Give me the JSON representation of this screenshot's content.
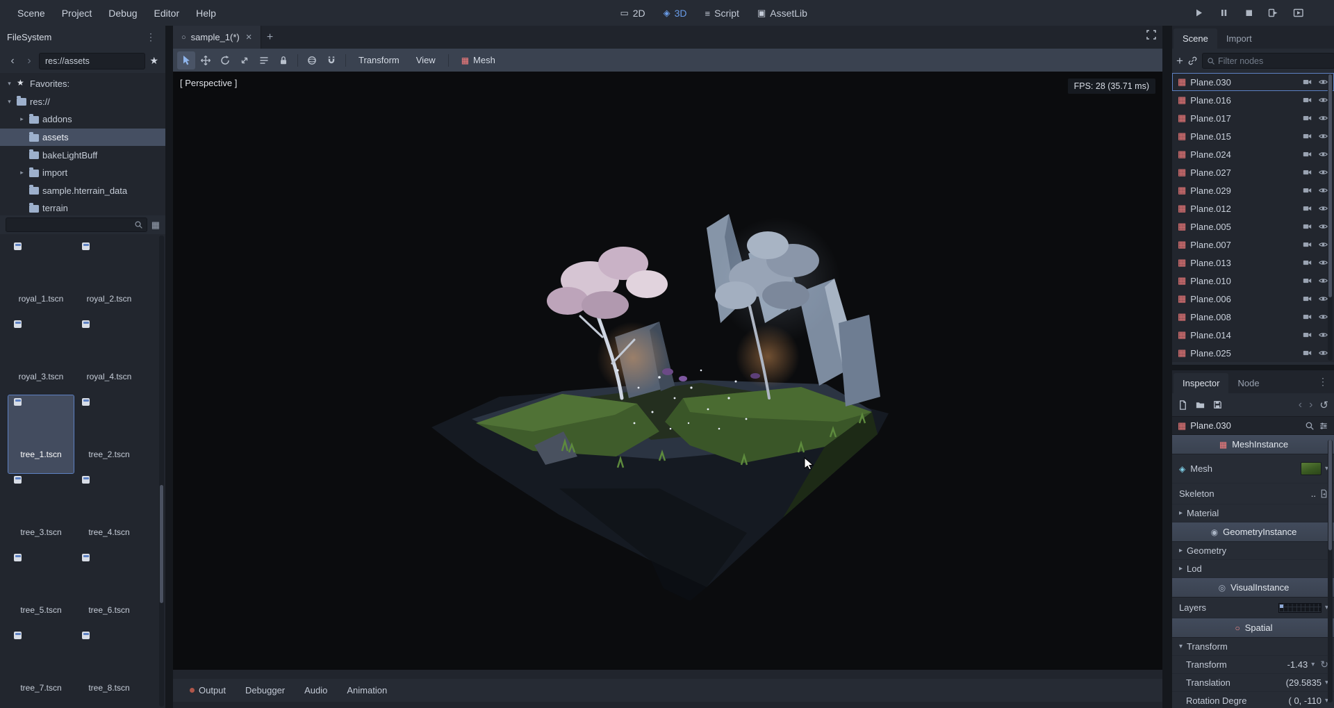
{
  "colors": {
    "accent": "#699ce8",
    "nodeicon": "#fc7f7f"
  },
  "menubar": {
    "menus": [
      "Scene",
      "Project",
      "Debug",
      "Editor",
      "Help"
    ],
    "workspaces": [
      {
        "label": "2D",
        "icon": "2d"
      },
      {
        "label": "3D",
        "icon": "3d",
        "active": true
      },
      {
        "label": "Script",
        "icon": "script"
      },
      {
        "label": "AssetLib",
        "icon": "assetlib"
      }
    ]
  },
  "filesystem": {
    "title": "FileSystem",
    "breadcrumb": "res://assets",
    "tree": [
      {
        "label": "Favorites:",
        "depth": 0,
        "icon": "star",
        "arrow": "down"
      },
      {
        "label": "res://",
        "depth": 0,
        "icon": "folder-open",
        "arrow": "down"
      },
      {
        "label": "addons",
        "depth": 1,
        "icon": "folder",
        "arrow": "right"
      },
      {
        "label": "assets",
        "depth": 1,
        "icon": "folder",
        "selected": true
      },
      {
        "label": "bakeLightBuff",
        "depth": 1,
        "icon": "folder"
      },
      {
        "label": "import",
        "depth": 1,
        "icon": "folder",
        "arrow": "right"
      },
      {
        "label": "sample.hterrain_data",
        "depth": 1,
        "icon": "folder"
      },
      {
        "label": "terrain",
        "depth": 1,
        "icon": "folder"
      }
    ],
    "files": [
      {
        "label": "royal_1.tscn",
        "type": "round",
        "colors": {
          "foliage": "#99953f",
          "trunk": "#5d4a33"
        }
      },
      {
        "label": "royal_2.tscn",
        "type": "round",
        "colors": {
          "foliage": "#7c8470",
          "trunk": "#5d4a33"
        }
      },
      {
        "label": "royal_3.tscn",
        "type": "round",
        "colors": {
          "foliage": "#4d9c49",
          "trunk": "#5d4a33"
        }
      },
      {
        "label": "royal_4.tscn",
        "type": "round",
        "colors": {
          "foliage": "#2f7c3c",
          "trunk": "#5d4a33"
        }
      },
      {
        "label": "tree_1.tscn",
        "type": "round",
        "selected": true,
        "colors": {
          "foliage": "#c6663c",
          "trunk": "#6b4a33"
        }
      },
      {
        "label": "tree_2.tscn",
        "type": "round",
        "colors": {
          "foliage": "#4f9e50",
          "trunk": "#6b4a33"
        }
      },
      {
        "label": "tree_3.tscn",
        "type": "round",
        "colors": {
          "foliage": "#c07a3e",
          "trunk": "#6b4a33"
        }
      },
      {
        "label": "tree_4.tscn",
        "type": "round",
        "colors": {
          "foliage": "#79ad47",
          "trunk": "#6b4a33"
        }
      },
      {
        "label": "tree_5.tscn",
        "type": "pine",
        "colors": {
          "foliage": "#3c6e4b",
          "trunk": "#6b4a33"
        }
      },
      {
        "label": "tree_6.tscn",
        "type": "pine",
        "colors": {
          "foliage": "#c08a3e",
          "trunk": "#6b4a33"
        }
      },
      {
        "label": "tree_7.tscn",
        "type": "pine",
        "colors": {
          "foliage": "#4a8a4c",
          "trunk": "#6b4a33"
        }
      },
      {
        "label": "tree_8.tscn",
        "type": "pine",
        "colors": {
          "foliage": "#d78fa4",
          "trunk": "#6b4a33"
        }
      }
    ]
  },
  "viewport": {
    "tab": "sample_1(*)",
    "perspective_label": "[ Perspective ]",
    "fps": "FPS: 28 (35.71 ms)",
    "menus": {
      "transform": "Transform",
      "view": "View",
      "mesh": "Mesh"
    }
  },
  "bottom_panel": {
    "tabs": [
      {
        "label": "Output",
        "classes": "with-dot"
      },
      {
        "label": "Debugger"
      },
      {
        "label": "Audio"
      },
      {
        "label": "Animation"
      }
    ]
  },
  "scene_dock": {
    "tabs": [
      {
        "label": "Scene",
        "active": true
      },
      {
        "label": "Import"
      }
    ],
    "filter_placeholder": "Filter nodes",
    "nodes": [
      {
        "name": "Plane.030",
        "focused": true
      },
      {
        "name": "Plane.016"
      },
      {
        "name": "Plane.017"
      },
      {
        "name": "Plane.015"
      },
      {
        "name": "Plane.024"
      },
      {
        "name": "Plane.027"
      },
      {
        "name": "Plane.029"
      },
      {
        "name": "Plane.012"
      },
      {
        "name": "Plane.005"
      },
      {
        "name": "Plane.007"
      },
      {
        "name": "Plane.013"
      },
      {
        "name": "Plane.010"
      },
      {
        "name": "Plane.006"
      },
      {
        "name": "Plane.008"
      },
      {
        "name": "Plane.014"
      },
      {
        "name": "Plane.025"
      }
    ]
  },
  "inspector": {
    "tabs": [
      {
        "label": "Inspector",
        "active": true
      },
      {
        "label": "Node"
      }
    ],
    "object_name": "Plane.030",
    "categories": {
      "meshinstance": "MeshInstance",
      "geometryinstance": "GeometryInstance",
      "visualinstance": "VisualInstance",
      "spatial": "Spatial"
    },
    "properties": {
      "mesh_label": "Mesh",
      "skeleton_label": "Skeleton",
      "skeleton_value": "..",
      "material_label": "Material",
      "geometry_label": "Geometry",
      "lod_label": "Lod",
      "layers_label": "Layers",
      "transform_group": "Transform",
      "transform_label": "Transform",
      "transform_value": "-1.43",
      "translation_label": "Translation",
      "translation_value": "(29.5835",
      "rotation_label": "Rotation Degre",
      "rotation_value": "( 0, -110"
    }
  }
}
